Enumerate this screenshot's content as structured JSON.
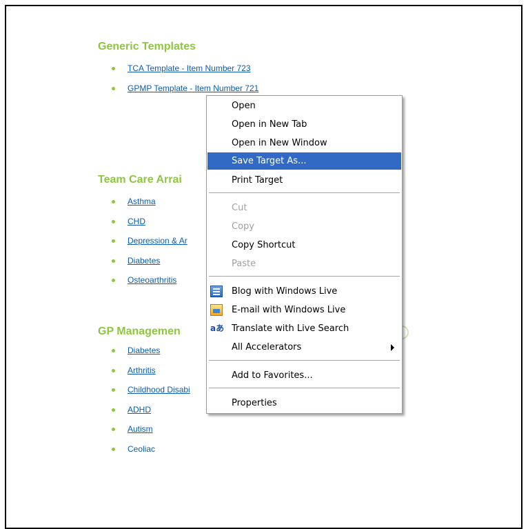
{
  "sections": [
    {
      "title": "Generic Templates",
      "links": [
        {
          "label": "TCA Template - Item Number 723"
        },
        {
          "label": "GPMP Template - Item Number 721"
        }
      ]
    },
    {
      "title": "Team Care Arrai",
      "links": [
        {
          "label": "Asthma"
        },
        {
          "label": "CHD"
        },
        {
          "label": "Depression & Ar"
        },
        {
          "label": "Diabetes"
        },
        {
          "label": "Osteoarthritis"
        }
      ]
    },
    {
      "title": "GP Managemen",
      "links": [
        {
          "label": "Diabetes"
        },
        {
          "label": "Arthritis"
        },
        {
          "label": "Childhood Disabi"
        },
        {
          "label": "ADHD"
        },
        {
          "label": "Autism"
        },
        {
          "label": "Ceoliac"
        }
      ]
    }
  ],
  "context_menu": {
    "items": [
      {
        "label": "Open",
        "state": "normal"
      },
      {
        "label": "Open in New Tab",
        "state": "normal"
      },
      {
        "label": "Open in New Window",
        "state": "normal"
      },
      {
        "label": "Save Target As...",
        "state": "selected"
      },
      {
        "label": "Print Target",
        "state": "normal"
      },
      {
        "label": "Cut",
        "state": "disabled"
      },
      {
        "label": "Copy",
        "state": "disabled"
      },
      {
        "label": "Copy Shortcut",
        "state": "normal"
      },
      {
        "label": "Paste",
        "state": "disabled"
      },
      {
        "label": "Blog with Windows Live",
        "state": "normal",
        "icon": "blog-icon"
      },
      {
        "label": "E-mail with Windows Live",
        "state": "normal",
        "icon": "email-icon"
      },
      {
        "label": "Translate with Live Search",
        "state": "normal",
        "icon": "translate-icon",
        "icon_glyph": "aあ"
      },
      {
        "label": "All Accelerators",
        "state": "normal",
        "icon": "submenu-arrow-icon"
      },
      {
        "label": "Add to Favorites...",
        "state": "normal"
      },
      {
        "label": "Properties",
        "state": "normal"
      }
    ]
  },
  "colors": {
    "heading": "#8dc63f",
    "link": "#0b5cb0",
    "menu_highlight": "#316ac5",
    "menu_disabled": "#a0a0a0"
  }
}
